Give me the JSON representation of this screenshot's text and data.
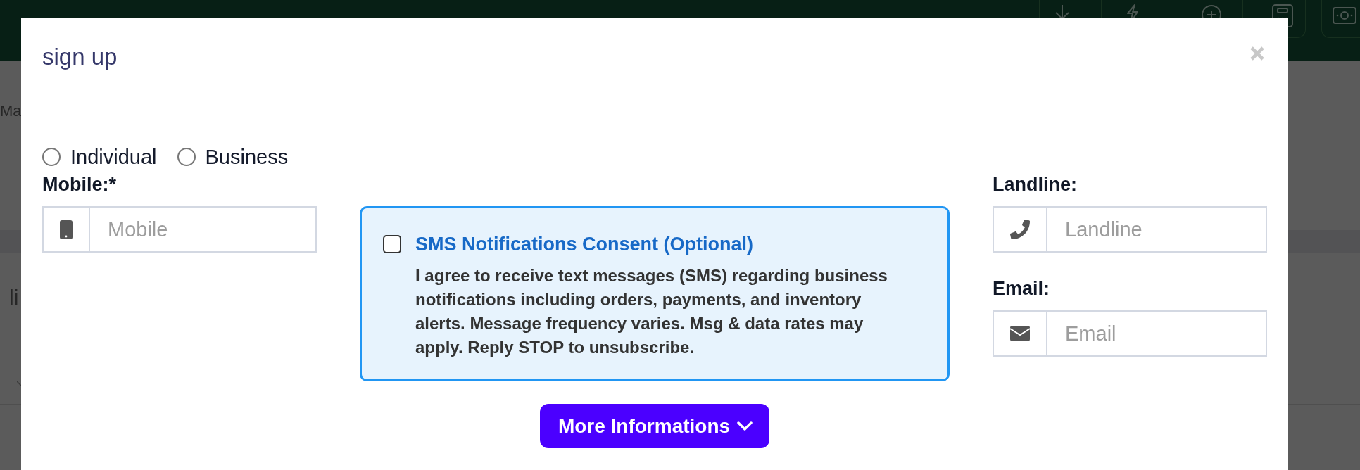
{
  "page_behind": {
    "texts": [
      "Ma",
      "li"
    ]
  },
  "modal": {
    "title": "sign up",
    "account_types": [
      {
        "label": "Individual",
        "selected": false
      },
      {
        "label": "Business",
        "selected": false
      }
    ],
    "mobile": {
      "label": "Mobile:*",
      "placeholder": "Mobile"
    },
    "sms_consent": {
      "checked": false,
      "title": "SMS Notifications Consent (Optional)",
      "text": "I agree to receive text messages (SMS) regarding business notifications including orders, payments, and inventory alerts. Message frequency varies. Msg & data rates may apply. Reply STOP to unsubscribe."
    },
    "more_button": {
      "label": "More Informations"
    },
    "landline": {
      "label": "Landline:",
      "placeholder": "Landline"
    },
    "email": {
      "label": "Email:",
      "placeholder": "Email"
    }
  }
}
